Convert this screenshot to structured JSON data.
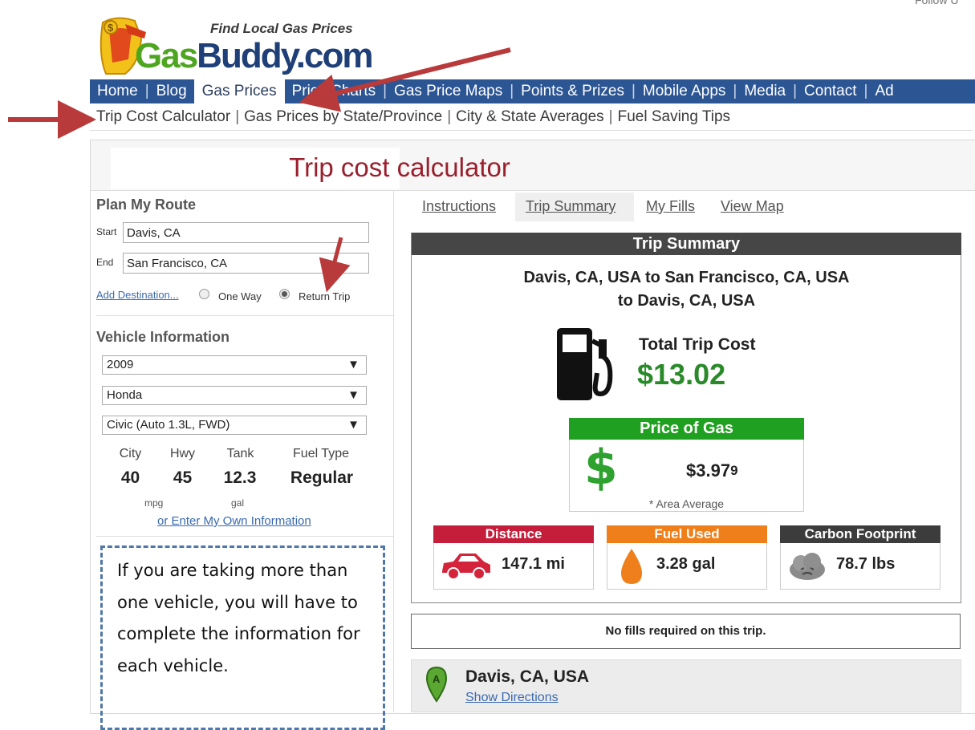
{
  "header": {
    "tagline": "Find Local Gas Prices",
    "logo_part1": "Gas",
    "logo_part2": "Buddy.com",
    "top_right_fragment": "Follow U"
  },
  "nav": {
    "items": [
      "Home",
      "Blog",
      "Gas Prices",
      "Price Charts",
      "Gas Price Maps",
      "Points & Prizes",
      "Mobile Apps",
      "Media",
      "Contact",
      "Ad"
    ],
    "active": "Gas Prices"
  },
  "subnav": {
    "items": [
      "Trip Cost Calculator",
      "Gas Prices by State/Province",
      "City & State Averages",
      "Fuel Saving Tips"
    ]
  },
  "page": {
    "title": "Trip cost calculator"
  },
  "route": {
    "heading": "Plan My Route",
    "start_label": "Start",
    "start_value": "Davis, CA",
    "end_label": "End",
    "end_value": "San Francisco, CA",
    "add_destination": "Add Destination...",
    "one_way": "One Way",
    "return_trip": "Return Trip",
    "selected": "Return Trip"
  },
  "vehicle": {
    "heading": "Vehicle Information",
    "year": "2009",
    "make": "Honda",
    "model": "Civic (Auto 1.3L, FWD)",
    "city_label": "City",
    "city_value": "40",
    "hwy_label": "Hwy",
    "hwy_value": "45",
    "tank_label": "Tank",
    "tank_value": "12.3",
    "fuel_label": "Fuel Type",
    "fuel_value": "Regular",
    "mpg_unit": "mpg",
    "gal_unit": "gal",
    "own_info_link": "or Enter My Own Information"
  },
  "note": {
    "text": "If you are taking more than one vehicle, you will have to complete the information for each vehicle."
  },
  "tabs": [
    "Instructions",
    "Trip Summary",
    "My Fills",
    "View Map"
  ],
  "summary": {
    "heading": "Trip Summary",
    "route_line1": "Davis, CA, USA to San Francisco, CA, USA",
    "route_line2": "to Davis, CA, USA",
    "total_label": "Total Trip Cost",
    "total_value": "$13.02",
    "price_heading": "Price of Gas",
    "price_value": "$3.97",
    "price_value_tenth": "9",
    "price_note": "* Area Average",
    "distance_label": "Distance",
    "distance_value": "147.1 mi",
    "fuel_label": "Fuel Used",
    "fuel_value": "3.28 gal",
    "carbon_label": "Carbon Footprint",
    "carbon_value": "78.7 lbs",
    "no_fills": "No fills required on this trip.",
    "stop_marker": "A",
    "stop_name": "Davis, CA, USA",
    "stop_link": "Show Directions"
  },
  "colors": {
    "nav_bg": "#2c5594",
    "title_red": "#9a1f2d",
    "money_green": "#2a8a2a",
    "distance_red": "#c41e3a",
    "fuel_orange": "#ef7f1a",
    "carbon_dark": "#3c3c3c",
    "arrow_red": "#b83a3a"
  }
}
